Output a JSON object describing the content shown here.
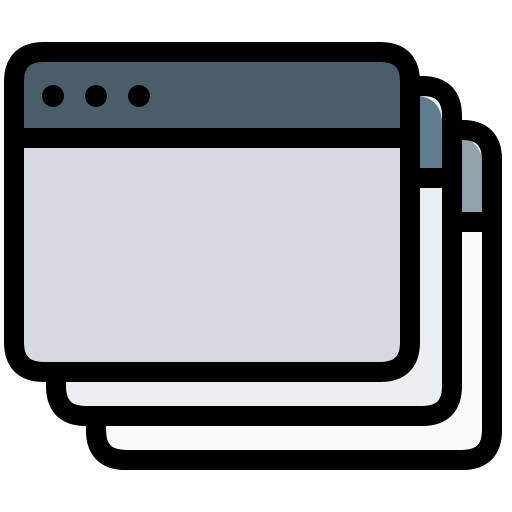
{
  "icon": {
    "name": "stacked-browser-windows-icon",
    "windows": [
      {
        "role": "back",
        "body_color": "#fafafa",
        "header_color": "#90a4ae"
      },
      {
        "role": "middle",
        "body_color": "#eceff1",
        "header_color": "#607d8b"
      },
      {
        "role": "front",
        "body_color": "#d4dadf",
        "header_color": "#4a5e6a"
      }
    ],
    "outline_color": "#000000",
    "header_dot_count": 3
  }
}
